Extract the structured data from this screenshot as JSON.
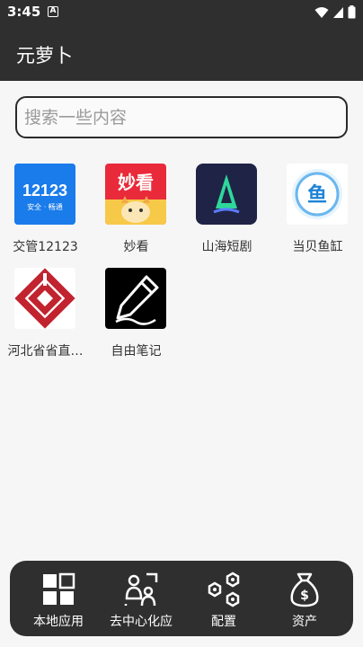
{
  "status_bar": {
    "time": "3:45",
    "notification_glyph": "A"
  },
  "app_bar": {
    "title": "元萝卜"
  },
  "search": {
    "placeholder": "搜索一些内容",
    "value": ""
  },
  "apps": [
    {
      "label": "交管12123",
      "icon": "jiaoguan-12123-icon",
      "icon_text": "12123",
      "icon_subtext": "安全 · 畅通",
      "color": "#1a7bea"
    },
    {
      "label": "妙看",
      "icon": "miaokan-icon",
      "icon_text": "妙看",
      "color": "#e92a3a"
    },
    {
      "label": "山海短剧",
      "icon": "shanhai-drama-icon",
      "color": "#1f2346"
    },
    {
      "label": "当贝鱼缸",
      "icon": "dangbei-fishtank-icon",
      "color": "#2a9ee0"
    },
    {
      "label": "河北省省直…",
      "icon": "hebei-gov-icon",
      "color": "#c1232f"
    },
    {
      "label": "自由笔记",
      "icon": "free-notes-icon",
      "color": "#000000"
    }
  ],
  "bottom_nav": [
    {
      "label": "本地应用",
      "icon": "grid-apps-icon"
    },
    {
      "label": "去中心化应",
      "icon": "users-scan-icon"
    },
    {
      "label": "配置",
      "icon": "hexagon-nodes-icon"
    },
    {
      "label": "资产",
      "icon": "money-bag-icon"
    }
  ],
  "colors": {
    "bar_bg": "#2f2f2f",
    "page_bg": "#f6f6f6",
    "text": "#333333"
  }
}
